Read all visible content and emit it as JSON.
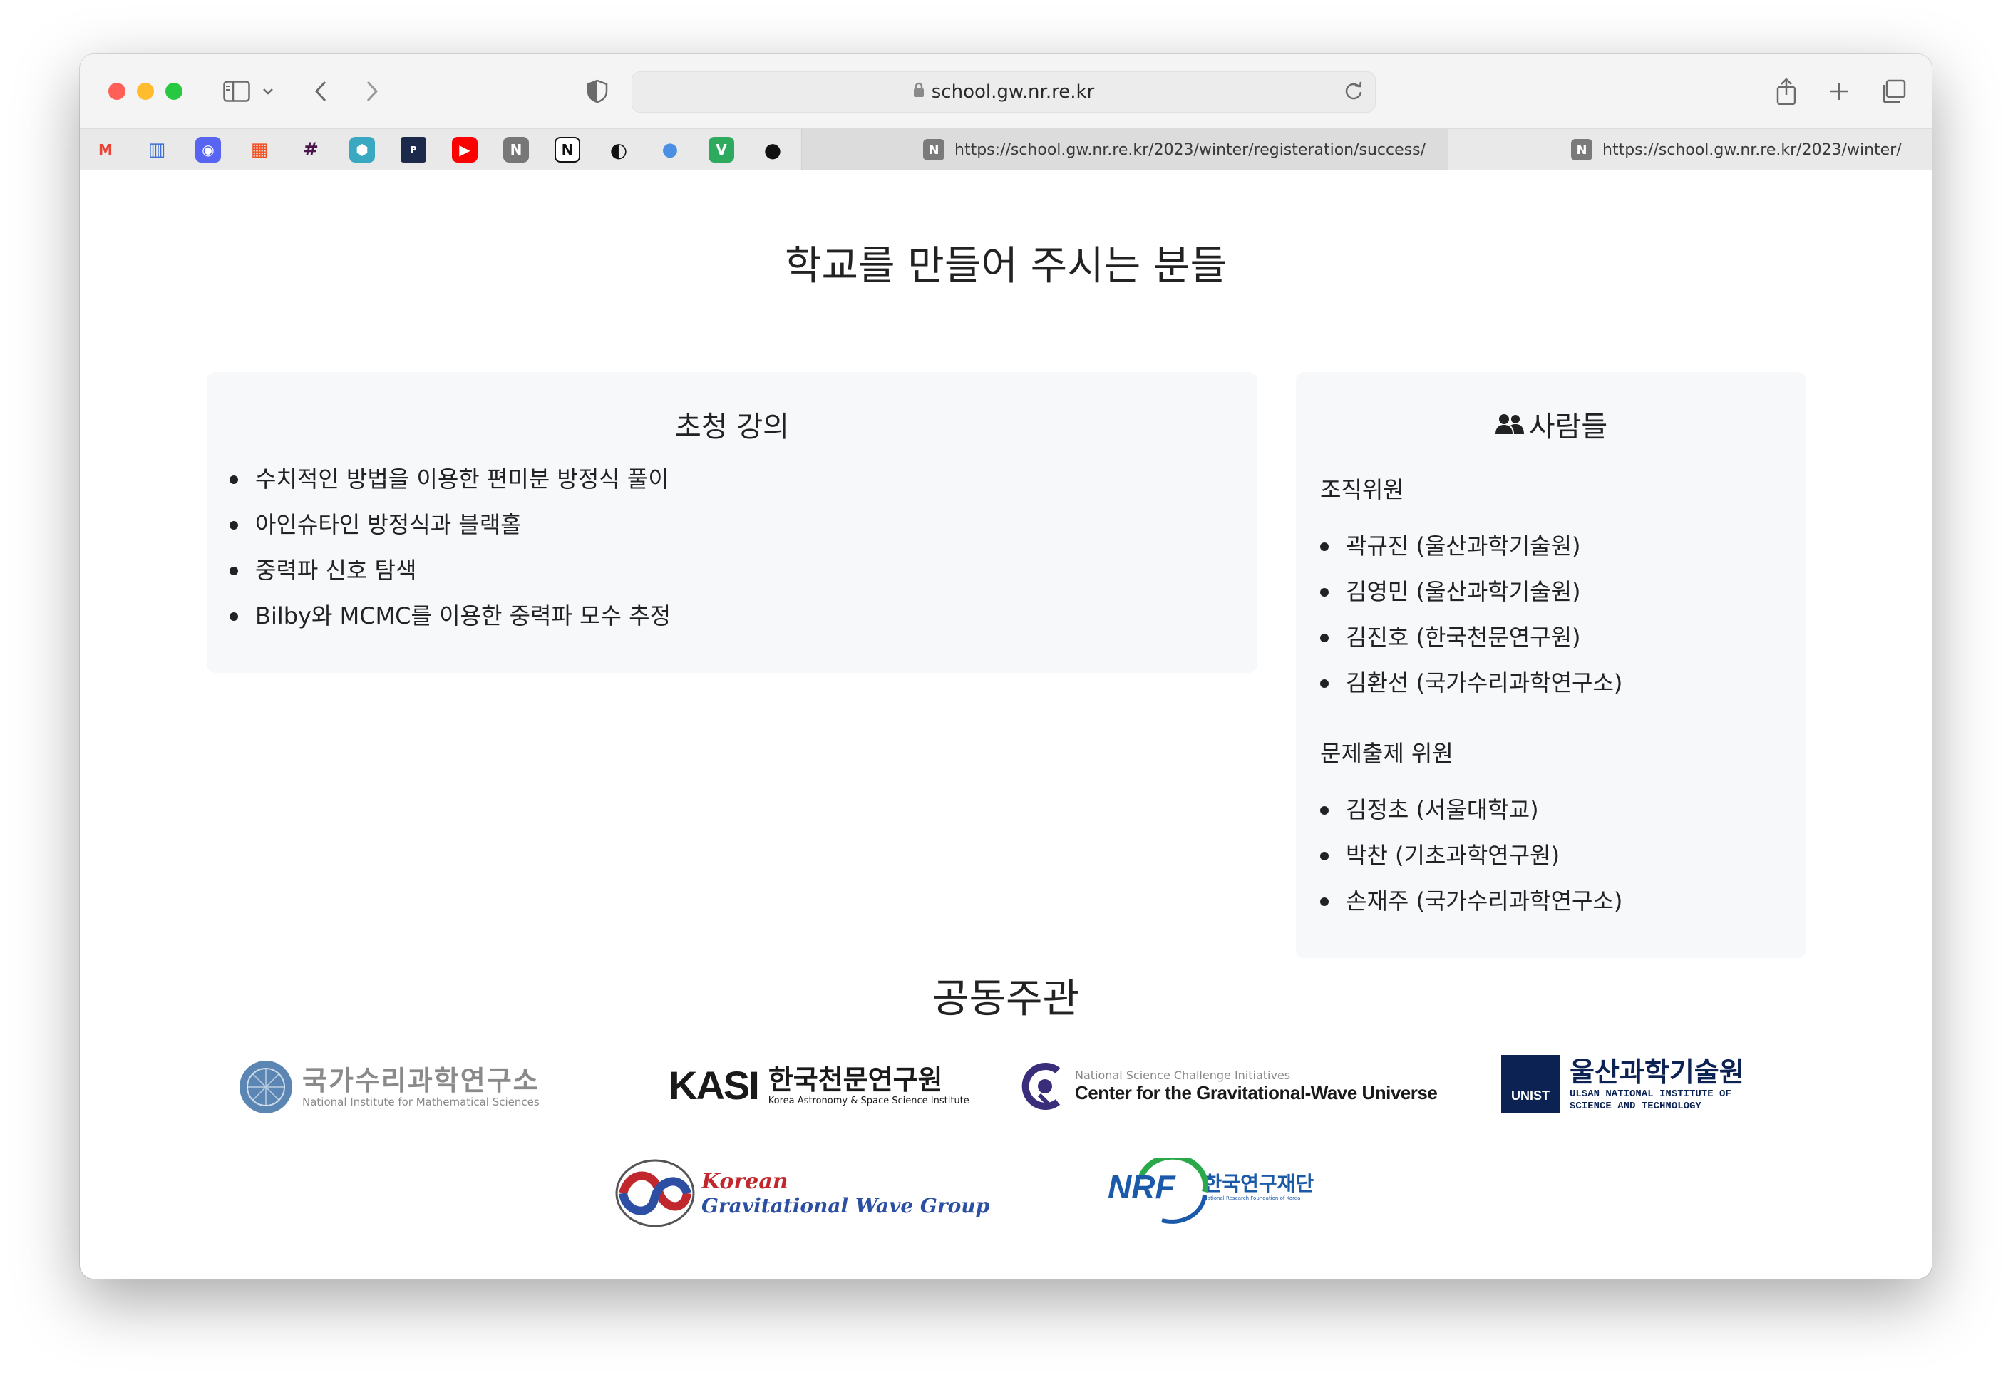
{
  "browser": {
    "address": "school.gw.nr.re.kr",
    "tabs": [
      {
        "url": "https://school.gw.nr.re.kr/2023/winter/registeration/success/",
        "active": true
      },
      {
        "url": "https://school.gw.nr.re.kr/2023/winter/",
        "active": false
      }
    ],
    "favorites": [
      {
        "icon": "gmail-icon",
        "glyph": "M",
        "color": "#ea4335"
      },
      {
        "icon": "barcode-icon",
        "glyph": "▥",
        "color": "#3d6fd8"
      },
      {
        "icon": "discord-icon",
        "glyph": "◉",
        "color": "#5865f2"
      },
      {
        "icon": "microsoft-icon",
        "glyph": "▦",
        "color": "#f25022"
      },
      {
        "icon": "slack-icon",
        "glyph": "#",
        "color": "#4a154b"
      },
      {
        "icon": "hexagon-icon",
        "glyph": "⬢",
        "color": "#3aa8c1"
      },
      {
        "icon": "primer-icon",
        "glyph": "P",
        "color": "#1b2a4a"
      },
      {
        "icon": "youtube-icon",
        "glyph": "▶",
        "color": "#ff0000"
      },
      {
        "icon": "notion-n-icon",
        "glyph": "N",
        "color": "#777777"
      },
      {
        "icon": "notion-icon",
        "glyph": "N",
        "color": "#111111"
      },
      {
        "icon": "fire-icon",
        "glyph": "◐",
        "color": "#111111"
      },
      {
        "icon": "person-icon",
        "glyph": "●",
        "color": "#4a90e2"
      },
      {
        "icon": "vim-icon",
        "glyph": "V",
        "color": "#2eaa5e"
      },
      {
        "icon": "github-icon",
        "glyph": "●",
        "color": "#111111"
      }
    ]
  },
  "page": {
    "title": "학교를 만들어 주시는 분들",
    "lectures": {
      "heading": "초청 강의",
      "items": [
        "수치적인 방법을 이용한 편미분 방정식 풀이",
        "아인슈타인 방정식과 블랙홀",
        "중력파 신호 탐색",
        "Bilby와 MCMC를 이용한 중력파 모수 추정"
      ]
    },
    "people": {
      "heading": "사람들",
      "organizers_label": "조직위원",
      "organizers": [
        "곽규진 (울산과학기술원)",
        "김영민 (울산과학기술원)",
        "김진호 (한국천문연구원)",
        "김환선 (국가수리과학연구소)"
      ],
      "problem_label": "문제출제 위원",
      "problem_setters": [
        "김정초 (서울대학교)",
        "박찬 (기초과학연구원)",
        "손재주 (국가수리과학연구소)"
      ]
    },
    "sponsors": {
      "heading": "공동주관",
      "nims": {
        "kr": "국가수리과학연구소",
        "en": "National Institute for Mathematical Sciences"
      },
      "kasi": {
        "mark": "KASI",
        "kr": "한국천문연구원",
        "en": "Korea Astronomy & Space Science Institute"
      },
      "cgwu": {
        "sub": "National Science Challenge Initiatives",
        "main": "Center for the Gravitational-Wave Universe"
      },
      "unist": {
        "mark": "UNIST",
        "kr": "울산과학기술원",
        "en1": "ULSAN NATIONAL INSTITUTE OF",
        "en2": "SCIENCE AND TECHNOLOGY"
      },
      "kgwg": {
        "line1": "Korean",
        "line2": "Gravitational Wave Group"
      },
      "nrf": {
        "mark": "NRF",
        "kr": "한국연구재단",
        "en": "National Research Foundation of Korea"
      }
    }
  },
  "colors": {
    "nims_blue": "#5b86b4",
    "kasi_blue": "#1b3f8f",
    "kgwg_blue": "#2c4fa3",
    "kgwg_red": "#c0282e",
    "nrf_blue": "#1b5aa8",
    "nrf_green": "#2aa84a",
    "unist_navy": "#0b2253"
  }
}
